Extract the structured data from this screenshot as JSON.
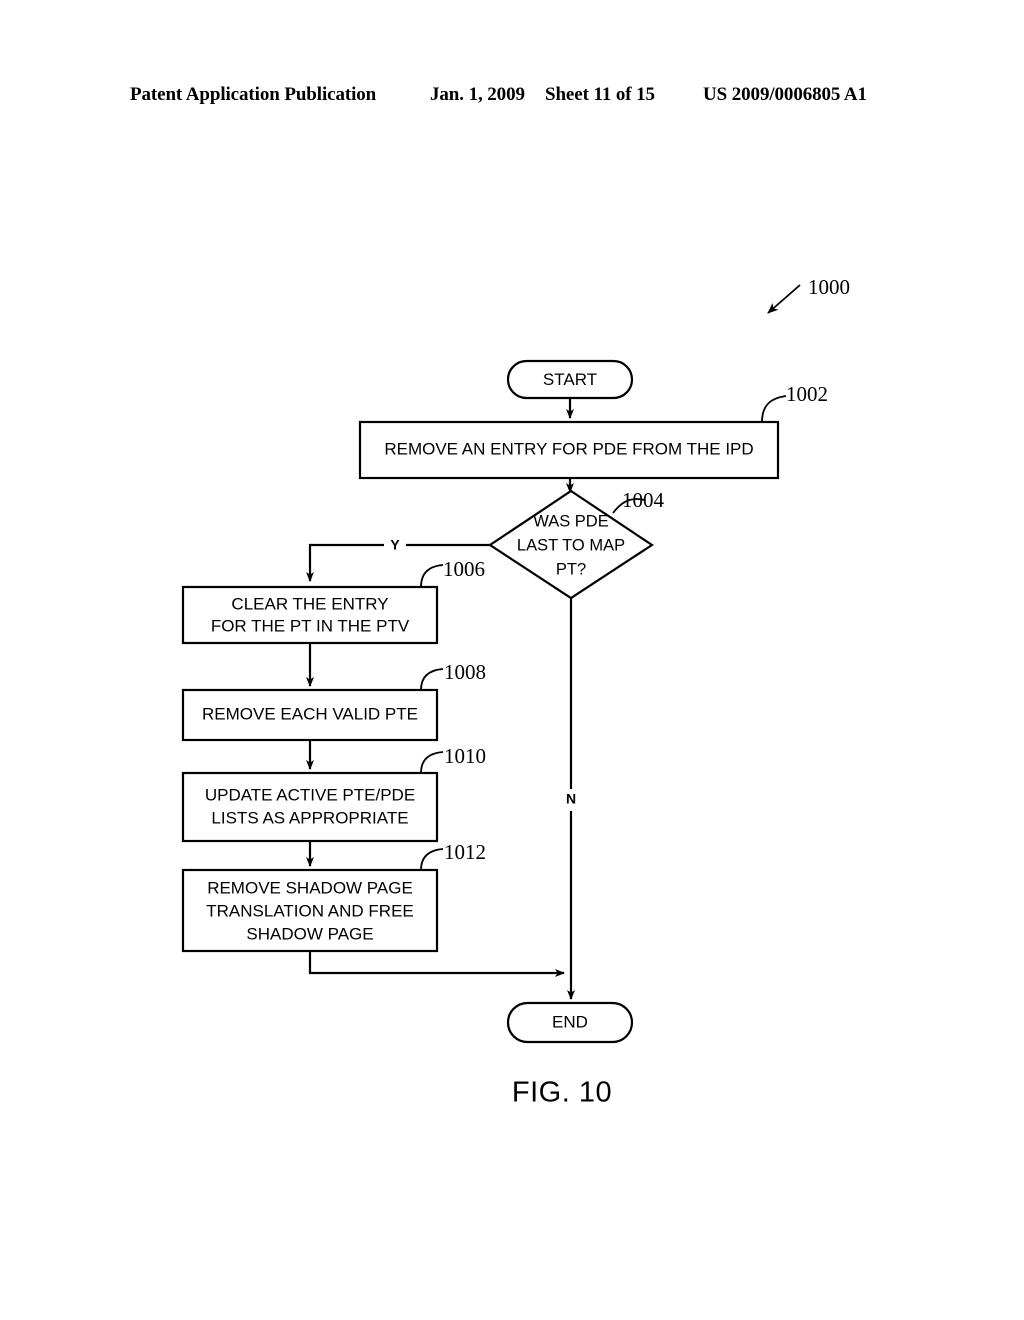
{
  "header": {
    "publication": "Patent Application Publication",
    "date": "Jan. 1, 2009",
    "sheet": "Sheet 11 of 15",
    "patent_number": "US 2009/0006805 A1"
  },
  "figure": {
    "label": "FIG. 10",
    "diagram_ref": "1000",
    "nodes": {
      "start": {
        "label": "START"
      },
      "step_1002": {
        "ref": "1002",
        "line1": "REMOVE AN ENTRY FOR PDE FROM THE IPD"
      },
      "decision_1004": {
        "ref": "1004",
        "line1": "WAS PDE",
        "line2": "LAST TO MAP",
        "line3": "PT?"
      },
      "step_1006": {
        "ref": "1006",
        "line1": "CLEAR THE ENTRY",
        "line2": "FOR THE PT IN THE PTV"
      },
      "step_1008": {
        "ref": "1008",
        "line1": "REMOVE EACH VALID PTE"
      },
      "step_1010": {
        "ref": "1010",
        "line1": "UPDATE ACTIVE PTE/PDE",
        "line2": "LISTS AS APPROPRIATE"
      },
      "step_1012": {
        "ref": "1012",
        "line1": "REMOVE SHADOW PAGE",
        "line2": "TRANSLATION AND FREE",
        "line3": "SHADOW PAGE"
      },
      "end": {
        "label": "END"
      }
    },
    "branches": {
      "yes": "Y",
      "no": "N"
    }
  },
  "colors": {
    "ink": "#000000",
    "paper": "#ffffff"
  }
}
